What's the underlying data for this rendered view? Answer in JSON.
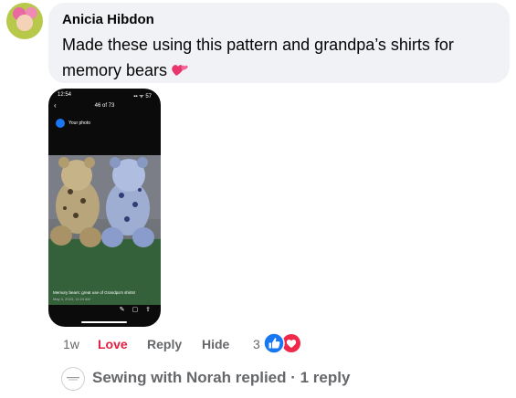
{
  "comment": {
    "author": "Anicia Hibdon",
    "text": "Made these using this pattern and grandpa’s shirts for memory bears"
  },
  "attachment": {
    "status_time": "12:54",
    "status_right": "▪▪ ᯤ 57",
    "count": "46 of 73",
    "header": "Your photo",
    "caption": "Memory bears: great use of Grandpa's shirts!",
    "date": "May 4, 2023, 11:24 AM"
  },
  "actions": {
    "time": "1w",
    "love": "Love",
    "reply": "Reply",
    "hide": "Hide",
    "reaction_count": "3"
  },
  "replies": {
    "text": "Sewing with Norah replied · 1 reply"
  },
  "colors": {
    "love": "#e41e3f",
    "like_blue": "#1877f2",
    "muted": "#65676b"
  }
}
